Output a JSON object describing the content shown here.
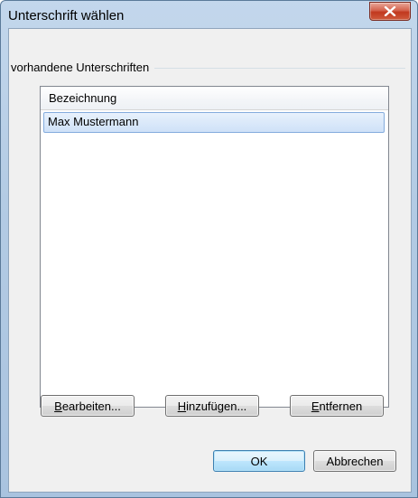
{
  "window": {
    "title": "Unterschrift wählen",
    "close_icon": "close-icon"
  },
  "group": {
    "label": "vorhandene Unterschriften"
  },
  "list": {
    "column_header": "Bezeichnung",
    "rows": [
      "Max Mustermann"
    ],
    "selected_index": 0
  },
  "buttons": {
    "edit": {
      "mnemonic": "B",
      "rest": "earbeiten..."
    },
    "add": {
      "mnemonic": "H",
      "rest": "inzufügen..."
    },
    "remove": {
      "mnemonic": "E",
      "rest": "ntfernen"
    },
    "ok": "OK",
    "cancel": "Abbrechen"
  },
  "colors": {
    "selection": "#cfe1f8",
    "selection_border": "#84acdd",
    "close_button": "#c1381e",
    "default_button_border": "#3c7fb1"
  }
}
